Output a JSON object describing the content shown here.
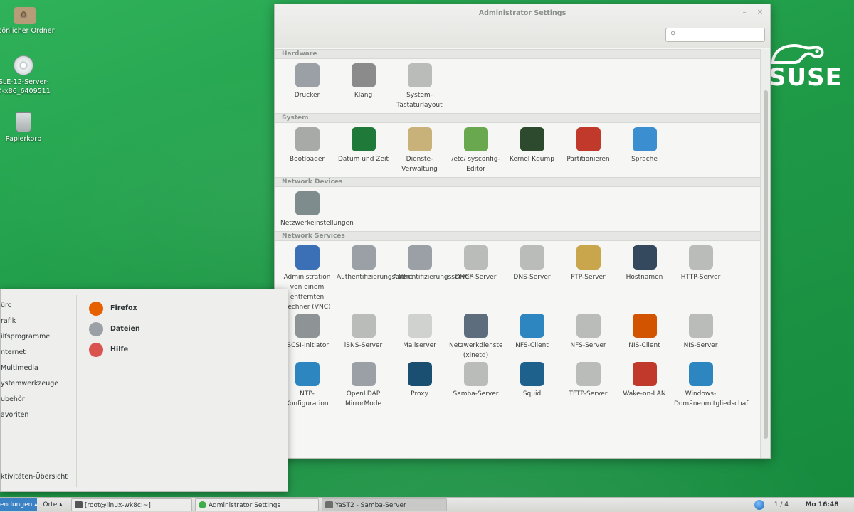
{
  "desktop": {
    "icons": [
      {
        "label": "rsönlicher Ordner",
        "icon": "home-folder-icon"
      },
      {
        "label": "SLE-12-Server-",
        "label2": "D-x86_6409511",
        "icon": "disc-icon"
      },
      {
        "label": "Papierkorb",
        "icon": "trash-icon"
      }
    ],
    "logo_text": "SUSE"
  },
  "window": {
    "title": "Administrator Settings",
    "search_placeholder": "",
    "sections": [
      {
        "title": "Hardware",
        "items": [
          {
            "label": "Drucker",
            "icon": "printer-icon",
            "color": "#9aa0a6"
          },
          {
            "label": "Klang",
            "icon": "speaker-icon",
            "color": "#8b8b8b"
          },
          {
            "label": "System-Tastaturlayout",
            "icon": "keyboard-icon",
            "color": "#b9bcb8"
          }
        ]
      },
      {
        "title": "System",
        "items": [
          {
            "label": "Bootloader",
            "icon": "power-icon",
            "color": "#a7aaa7"
          },
          {
            "label": "Datum und Zeit",
            "icon": "world-map-icon",
            "color": "#1f7a3a"
          },
          {
            "label": "Dienste-Verwaltung",
            "icon": "rocket-icon",
            "color": "#c9b27a"
          },
          {
            "label": "/etc/ sysconfig-Editor",
            "icon": "wrench-icon",
            "color": "#6aa84f"
          },
          {
            "label": "Kernel Kdump",
            "icon": "terminal-icon",
            "color": "#2e4a2e"
          },
          {
            "label": "Partitionieren",
            "icon": "disk-pie-icon",
            "color": "#c0392b"
          },
          {
            "label": "Sprache",
            "icon": "flag-icon",
            "color": "#3b8ed0"
          }
        ]
      },
      {
        "title": "Network Devices",
        "items": [
          {
            "label": "Netzwerkeinstellungen",
            "icon": "network-card-icon",
            "color": "#7f8c8d"
          }
        ]
      },
      {
        "title": "Network Services",
        "items": [
          {
            "label": "Administration von einem entfernten Rechner (VNC)",
            "icon": "remote-desktop-icon",
            "color": "#3b6fb6"
          },
          {
            "label": "Authentifizierungsclient",
            "icon": "auth-client-icon",
            "color": "#9aa0a6"
          },
          {
            "label": "Authentifizierungsserver",
            "icon": "auth-server-icon",
            "color": "#9aa0a6"
          },
          {
            "label": "DHCP-Server",
            "icon": "dhcp-server-icon",
            "color": "#b9bcb8"
          },
          {
            "label": "DNS-Server",
            "icon": "dns-server-icon",
            "color": "#b9bcb8"
          },
          {
            "label": "FTP-Server",
            "icon": "ftp-server-icon",
            "color": "#c9a64b"
          },
          {
            "label": "Hostnamen",
            "icon": "monitor-icon",
            "color": "#34495e"
          },
          {
            "label": "HTTP-Server",
            "icon": "http-server-icon",
            "color": "#b9bcb8"
          },
          {
            "label": "iSCSI-Initiator",
            "icon": "iscsi-icon",
            "color": "#8e9396"
          },
          {
            "label": "iSNS-Server",
            "icon": "isns-server-icon",
            "color": "#b9bcb8"
          },
          {
            "label": "Mailserver",
            "icon": "mail-icon",
            "color": "#cfd2cf"
          },
          {
            "label": "Netzwerkdienste (xinetd)",
            "icon": "network-services-icon",
            "color": "#5d6d7e"
          },
          {
            "label": "NFS-Client",
            "icon": "nfs-client-icon",
            "color": "#2e86c1"
          },
          {
            "label": "NFS-Server",
            "icon": "nfs-server-icon",
            "color": "#b9bcb8"
          },
          {
            "label": "NIS-Client",
            "icon": "nis-client-icon",
            "color": "#d35400"
          },
          {
            "label": "NIS-Server",
            "icon": "nis-server-icon",
            "color": "#b9bcb8"
          },
          {
            "label": "NTP-Konfiguration",
            "icon": "clock-icon",
            "color": "#2e86c1"
          },
          {
            "label": "OpenLDAP MirrorMode",
            "icon": "ldap-icon",
            "color": "#9aa0a6"
          },
          {
            "label": "Proxy",
            "icon": "proxy-icon",
            "color": "#1b4f72"
          },
          {
            "label": "Samba-Server",
            "icon": "samba-server-icon",
            "color": "#b9bcb8"
          },
          {
            "label": "Squid",
            "icon": "squid-icon",
            "color": "#1f618d"
          },
          {
            "label": "TFTP-Server",
            "icon": "tftp-server-icon",
            "color": "#b9bcb8"
          },
          {
            "label": "Wake-on-LAN",
            "icon": "wake-on-lan-icon",
            "color": "#c0392b"
          },
          {
            "label": "Windows-Domänenmitgliedschaft",
            "icon": "windows-domain-icon",
            "color": "#2e86c1"
          }
        ]
      }
    ]
  },
  "menu": {
    "categories": [
      "üro",
      "rafik",
      "ilfsprogramme",
      "nternet",
      "Multimedia",
      "ystemwerkzeuge",
      "ubehör",
      "avoriten"
    ],
    "apps": [
      {
        "label": "Firefox",
        "icon": "firefox-icon",
        "color": "#e66000"
      },
      {
        "label": "Dateien",
        "icon": "files-icon",
        "color": "#9aa0a6"
      },
      {
        "label": "Hilfe",
        "icon": "lifebuoy-icon",
        "color": "#d9534f"
      }
    ],
    "overview": "ktivitäten-Übersicht"
  },
  "taskbar": {
    "apps_label": "endungen ▴",
    "places_label": "Orte ▴",
    "tasks": [
      {
        "label": "[root@linux-wk8c:~]",
        "icon": "terminal-icon",
        "active": false
      },
      {
        "label": "Administrator Settings",
        "icon": "yast-icon",
        "active": false
      },
      {
        "label": "YaST2 - Samba-Server",
        "icon": "yast-window-icon",
        "active": true
      }
    ],
    "workspace": "1 / 4",
    "clock": "Mo 16:48"
  }
}
